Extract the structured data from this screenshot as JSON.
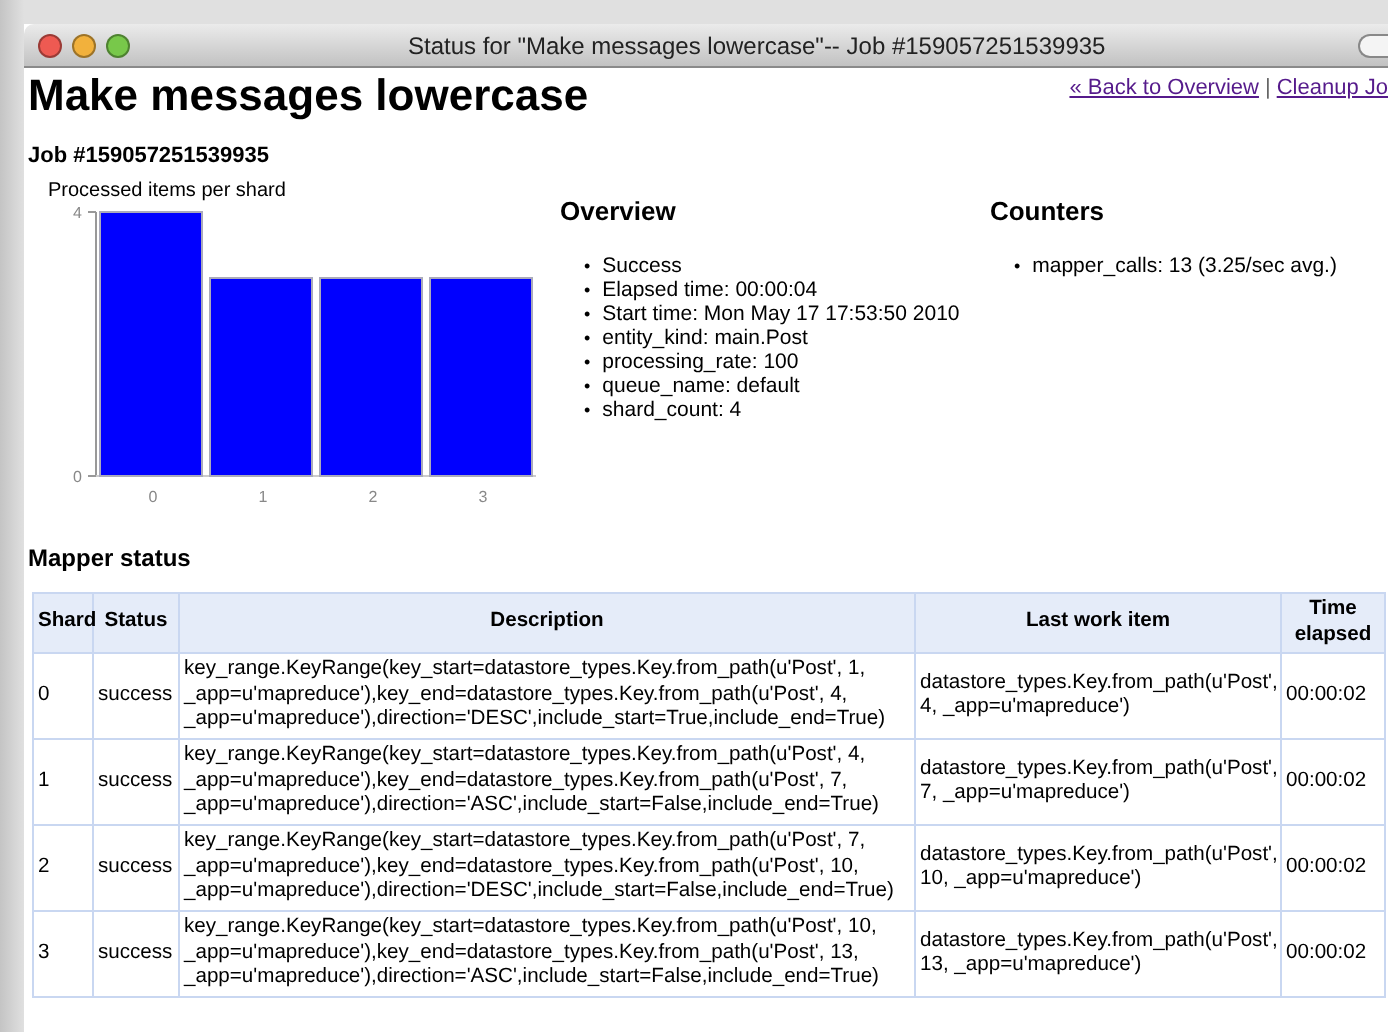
{
  "window": {
    "title": "Status for \"Make messages lowercase\"-- Job #159057251539935"
  },
  "header": {
    "title": "Make messages lowercase",
    "links": [
      "« Back to Overview",
      "Cleanup Jo"
    ],
    "separator": "|"
  },
  "job_id": "Job #159057251539935",
  "chart": {
    "chart_data": {
      "type": "bar",
      "title": "Processed items per shard",
      "categories": [
        "0",
        "1",
        "2",
        "3"
      ],
      "series": [
        {
          "color": "#0000ff",
          "values": [
            4,
            3,
            3,
            3
          ]
        }
      ],
      "ylim": [
        0,
        4
      ],
      "yticks": [
        0,
        4
      ]
    }
  },
  "overview": {
    "title": "Overview",
    "bullet": "•",
    "items": [
      "Success",
      "Elapsed time: 00:00:04",
      "Start time: Mon May 17 17:53:50 2010",
      "entity_kind: main.Post",
      "processing_rate: 100",
      "queue_name: default",
      "shard_count: 4"
    ]
  },
  "counters": {
    "title": "Counters",
    "bullet": "•",
    "items": [
      "mapper_calls: 13 (3.25/sec avg.)"
    ]
  },
  "mapper_status": {
    "title": "Mapper status",
    "columns": [
      "Shard",
      "Status",
      "Description",
      "Last work item",
      "Time elapsed"
    ],
    "rows": [
      [
        "0",
        "success",
        "key_range.KeyRange(key_start=datastore_types.Key.from_path(u'Post', 1, _app=u'mapreduce'),key_end=datastore_types.Key.from_path(u'Post', 4, _app=u'mapreduce'),direction='DESC',include_start=True,include_end=True)",
        "datastore_types.Key.from_path(u'Post', 4, _app=u'mapreduce')",
        "00:00:02"
      ],
      [
        "1",
        "success",
        "key_range.KeyRange(key_start=datastore_types.Key.from_path(u'Post', 4, _app=u'mapreduce'),key_end=datastore_types.Key.from_path(u'Post', 7, _app=u'mapreduce'),direction='ASC',include_start=False,include_end=True)",
        "datastore_types.Key.from_path(u'Post', 7, _app=u'mapreduce')",
        "00:00:02"
      ],
      [
        "2",
        "success",
        "key_range.KeyRange(key_start=datastore_types.Key.from_path(u'Post', 7, _app=u'mapreduce'),key_end=datastore_types.Key.from_path(u'Post', 10, _app=u'mapreduce'),direction='DESC',include_start=False,include_end=True)",
        "datastore_types.Key.from_path(u'Post', 10, _app=u'mapreduce')",
        "00:00:02"
      ],
      [
        "3",
        "success",
        "key_range.KeyRange(key_start=datastore_types.Key.from_path(u'Post', 10, _app=u'mapreduce'),key_end=datastore_types.Key.from_path(u'Post', 13, _app=u'mapreduce'),direction='ASC',include_start=False,include_end=True)",
        "datastore_types.Key.from_path(u'Post', 13, _app=u'mapreduce')",
        "00:00:02"
      ]
    ]
  }
}
